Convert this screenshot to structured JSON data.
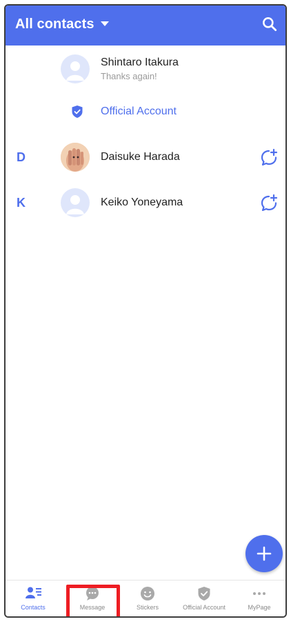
{
  "header": {
    "title": "All contacts"
  },
  "contacts": [
    {
      "name": "Shintaro Itakura",
      "status": "Thanks again!"
    },
    {
      "name": "Official Account"
    },
    {
      "index_letter": "D",
      "name": "Daisuke Harada"
    },
    {
      "index_letter": "K",
      "name": "Keiko Yoneyama"
    }
  ],
  "tabs": [
    {
      "label": "Contacts",
      "icon": "contacts-icon",
      "active": true
    },
    {
      "label": "Message",
      "icon": "message-icon"
    },
    {
      "label": "Stickers",
      "icon": "sticker-icon"
    },
    {
      "label": "Official Account",
      "icon": "shield-icon"
    },
    {
      "label": "MyPage",
      "icon": "more-icon"
    }
  ],
  "colors": {
    "accent": "#4f6fec",
    "highlight": "#ee1d23"
  }
}
